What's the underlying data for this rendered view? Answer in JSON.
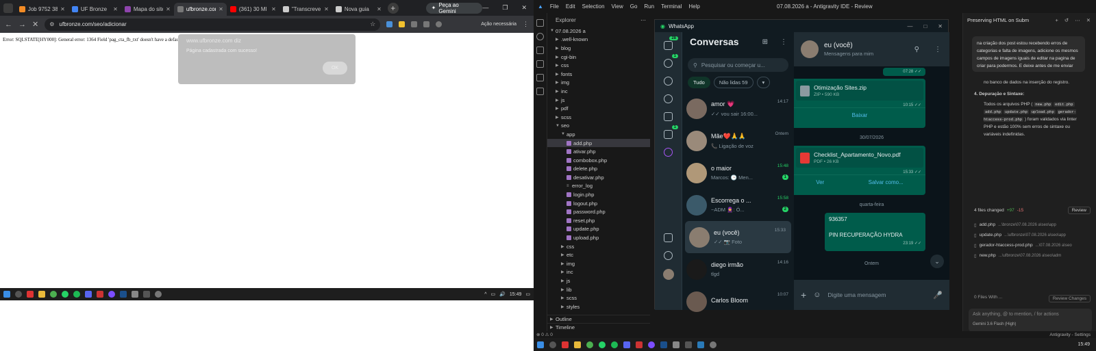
{
  "browser": {
    "tabs": [
      {
        "label": "Job 9752 38",
        "color": "#f28b25"
      },
      {
        "label": "UF Bronze",
        "color": "#4285f4"
      },
      {
        "label": "Mapa do site",
        "color": "#8e44ad"
      },
      {
        "label": "ufbronze.com",
        "color": "#777777"
      },
      {
        "label": "(361) 30 MI",
        "color": "#ff0000"
      },
      {
        "label": "\"Transcreve",
        "color": "#cccccc"
      },
      {
        "label": "Nova guia",
        "color": "#cccccc"
      }
    ],
    "active_tab": 3,
    "gemini_button": "Peça ao Gemini",
    "url": "ufbronze.com/seo/adicionar",
    "action_label": "Ação necessária"
  },
  "page": {
    "error_text": "Error: SQLSTATE[HY000]: General error: 1364 Field 'pag_cta_fb_txt' doesn't have a default value"
  },
  "alert": {
    "title": "www.ufbronze.com diz",
    "message": "Página cadastrada com sucesso!",
    "ok_label": "OK"
  },
  "taskbar_left": {
    "time": "15:49"
  },
  "ide": {
    "menu": [
      "File",
      "Edit",
      "Selection",
      "View",
      "Go",
      "Run",
      "Terminal",
      "Help"
    ],
    "title": "07.08.2026 a - Antigravity IDE - Review",
    "explorer_title": "Explorer",
    "root": "07.08.2026 a",
    "tree": [
      {
        "label": ".well-known",
        "type": "folder",
        "depth": 1
      },
      {
        "label": "blog",
        "type": "folder",
        "depth": 1
      },
      {
        "label": "cgi-bin",
        "type": "folder",
        "depth": 1
      },
      {
        "label": "css",
        "type": "folder",
        "depth": 1
      },
      {
        "label": "fonts",
        "type": "folder",
        "depth": 1
      },
      {
        "label": "img",
        "type": "folder",
        "depth": 1
      },
      {
        "label": "inc",
        "type": "folder",
        "depth": 1
      },
      {
        "label": "js",
        "type": "folder",
        "depth": 1
      },
      {
        "label": "pdf",
        "type": "folder",
        "depth": 1
      },
      {
        "label": "scss",
        "type": "folder",
        "depth": 1
      },
      {
        "label": "seo",
        "type": "folder-open",
        "depth": 1
      },
      {
        "label": "app",
        "type": "folder-open",
        "depth": 2
      },
      {
        "label": "add.php",
        "type": "php",
        "depth": 3,
        "selected": true
      },
      {
        "label": "ativar.php",
        "type": "php",
        "depth": 3
      },
      {
        "label": "combobox.php",
        "type": "php",
        "depth": 3
      },
      {
        "label": "delete.php",
        "type": "php",
        "depth": 3
      },
      {
        "label": "desativar.php",
        "type": "php",
        "depth": 3
      },
      {
        "label": "error_log",
        "type": "file",
        "depth": 3
      },
      {
        "label": "login.php",
        "type": "php",
        "depth": 3
      },
      {
        "label": "logout.php",
        "type": "php",
        "depth": 3
      },
      {
        "label": "password.php",
        "type": "php",
        "depth": 3
      },
      {
        "label": "reset.php",
        "type": "php",
        "depth": 3
      },
      {
        "label": "update.php",
        "type": "php",
        "depth": 3
      },
      {
        "label": "upload.php",
        "type": "php",
        "depth": 3
      },
      {
        "label": "css",
        "type": "folder",
        "depth": 2
      },
      {
        "label": "etc",
        "type": "folder",
        "depth": 2
      },
      {
        "label": "img",
        "type": "folder",
        "depth": 2
      },
      {
        "label": "inc",
        "type": "folder",
        "depth": 2
      },
      {
        "label": "js",
        "type": "folder",
        "depth": 2
      },
      {
        "label": "lib",
        "type": "folder",
        "depth": 2
      },
      {
        "label": "scss",
        "type": "folder",
        "depth": 2
      },
      {
        "label": "styles",
        "type": "folder",
        "depth": 2
      }
    ],
    "outline": "Outline",
    "timeline": "Timeline",
    "status_left": "⊗ 0 ⚠ 0",
    "status_right": "Antigravity - Settings",
    "clock": "15:49"
  },
  "whatsapp": {
    "window_title": "WhatsApp",
    "rail_badges": {
      "chats": "28",
      "calls": "1",
      "status": "1"
    },
    "list_title": "Conversas",
    "search_placeholder": "Pesquisar ou começar u...",
    "chips": [
      "Tudo",
      "Não lidas 59"
    ],
    "chats": [
      {
        "name": "amor 💗",
        "preview": "✓✓ vou sair 16:00...",
        "time": "14:17",
        "avatar": "#7a6a60"
      },
      {
        "name": "Mãe❤️🙏🙏",
        "preview": "📞 Ligação de voz",
        "time": "Ontem",
        "avatar": "#9a8a7a"
      },
      {
        "name": "o maior",
        "preview": "Marcos: 🕒 Men...",
        "time": "15:48",
        "unread": "1",
        "avatar": "#b09878"
      },
      {
        "name": "Escorrega o ...",
        "preview": "~ADM 🧕: Ó...",
        "time": "15:58",
        "unread": "2",
        "avatar": "#3b5a6a"
      },
      {
        "name": "eu (você)",
        "preview": "✓✓ 📷 Foto",
        "time": "15:33",
        "avatar": "#8a7d70",
        "selected": true
      },
      {
        "name": "diego irmão",
        "preview": "tlgd",
        "time": "14:16",
        "avatar": "#1a1a1a"
      },
      {
        "name": "Carlos Bloom",
        "preview": "",
        "time": "10:07",
        "avatar": "#6a5a50"
      }
    ],
    "conversation": {
      "name": "eu (você)",
      "subtitle": "Mensagens para mim",
      "messages": {
        "m0_time": "07:28 ✓✓",
        "m1_name": "Otimização Sites.zip",
        "m1_meta": "ZIP • 590 KB",
        "m1_time": "10:15 ✓✓",
        "m1_action": "Baixar",
        "date1": "30/07/2026",
        "m2_name": "Checklist_Apartamento_Novo.pdf",
        "m2_meta": "PDF • 26 KB",
        "m2_time": "15:33 ✓✓",
        "m2_actions": [
          "Ver",
          "Salvar como..."
        ],
        "date2": "quarta-feira",
        "m3_line1": "936357",
        "m3_line2": "PIN RECUPERAÇÃO HYDRA",
        "m3_time": "23:19 ✓✓",
        "date3": "Ontem"
      },
      "composer_placeholder": "Digite uma mensagem"
    }
  },
  "agent": {
    "title": "Preserving HTML on Subm",
    "user_message": "na criação dos post estou recebendo erros de categorias e falta de imagens, adicione os mesmos campos de imagens iguais de editar na pagina de criar para podermos. E deixe antes de me enviar",
    "body_line": "no banco de dados na inserção do registro.",
    "section": "4. Depuração e Sintaxe:",
    "bullet_pre": "Todos os arquivos PHP (",
    "codes": [
      "new.php",
      "edit.php",
      "add.php",
      "update.php",
      "upload.php",
      "gerador-htaccess-prod.php"
    ],
    "bullet_post": ") foram validados via linter PHP e estão 100% sem erros de sintaxe ou variáveis indefinidas.",
    "files_changed": "4 files changed",
    "diff_add": "+97",
    "diff_del": "-15",
    "review_label": "Review",
    "files": [
      {
        "name": "add.php",
        "path": "...\\bronze\\07.08.2026 a\\seo\\app"
      },
      {
        "name": "update.php",
        "path": "...\\ufbronze\\07.08.2026 a\\seo\\app"
      },
      {
        "name": "gerador-htaccess-prod.php",
        "path": "...\\07.08.2026 a\\seo"
      },
      {
        "name": "new.php",
        "path": "...\\ufbronze\\07.08.2026 a\\seo\\adm"
      }
    ],
    "files_with": "0 Files With ...",
    "review_changes": "Review Changes",
    "input_placeholder": "Ask anything, @ to mention, / for actions",
    "model": "Gemini 3.6 Flash (High)"
  }
}
